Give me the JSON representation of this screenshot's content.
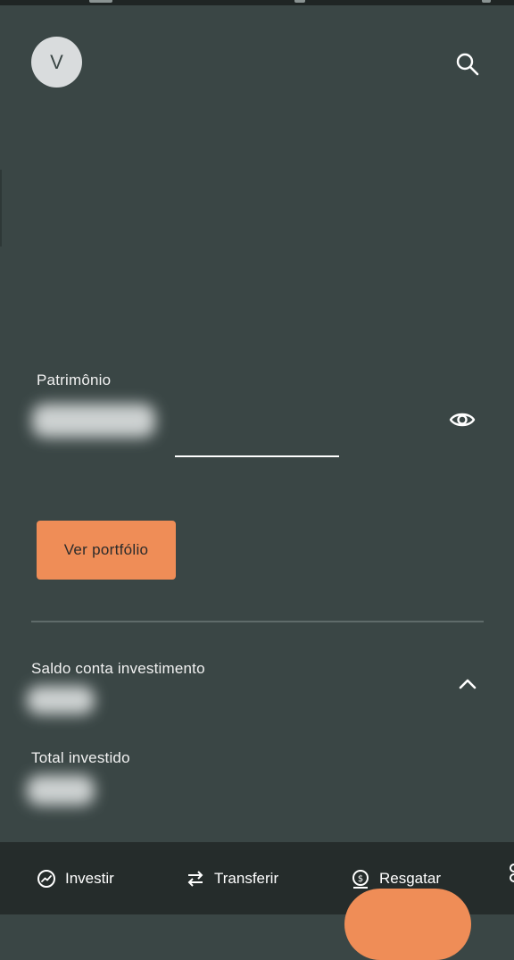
{
  "profile": {
    "initial": "V"
  },
  "wealth": {
    "label": "Patrimônio"
  },
  "actions": {
    "portfolio_label": "Ver portfólio"
  },
  "accounts": [
    {
      "label": "Saldo conta investimento"
    },
    {
      "label": "Total investido"
    }
  ],
  "bottom_nav": [
    {
      "label": "Investir",
      "icon": "trending-up-icon"
    },
    {
      "label": "Transferir",
      "icon": "swap-arrows-icon"
    },
    {
      "label": "Resgatar",
      "icon": "dollar-withdraw-icon"
    }
  ],
  "colors": {
    "background": "#3a4645",
    "accent": "#ef8d57",
    "nav_background": "#252c2b"
  }
}
